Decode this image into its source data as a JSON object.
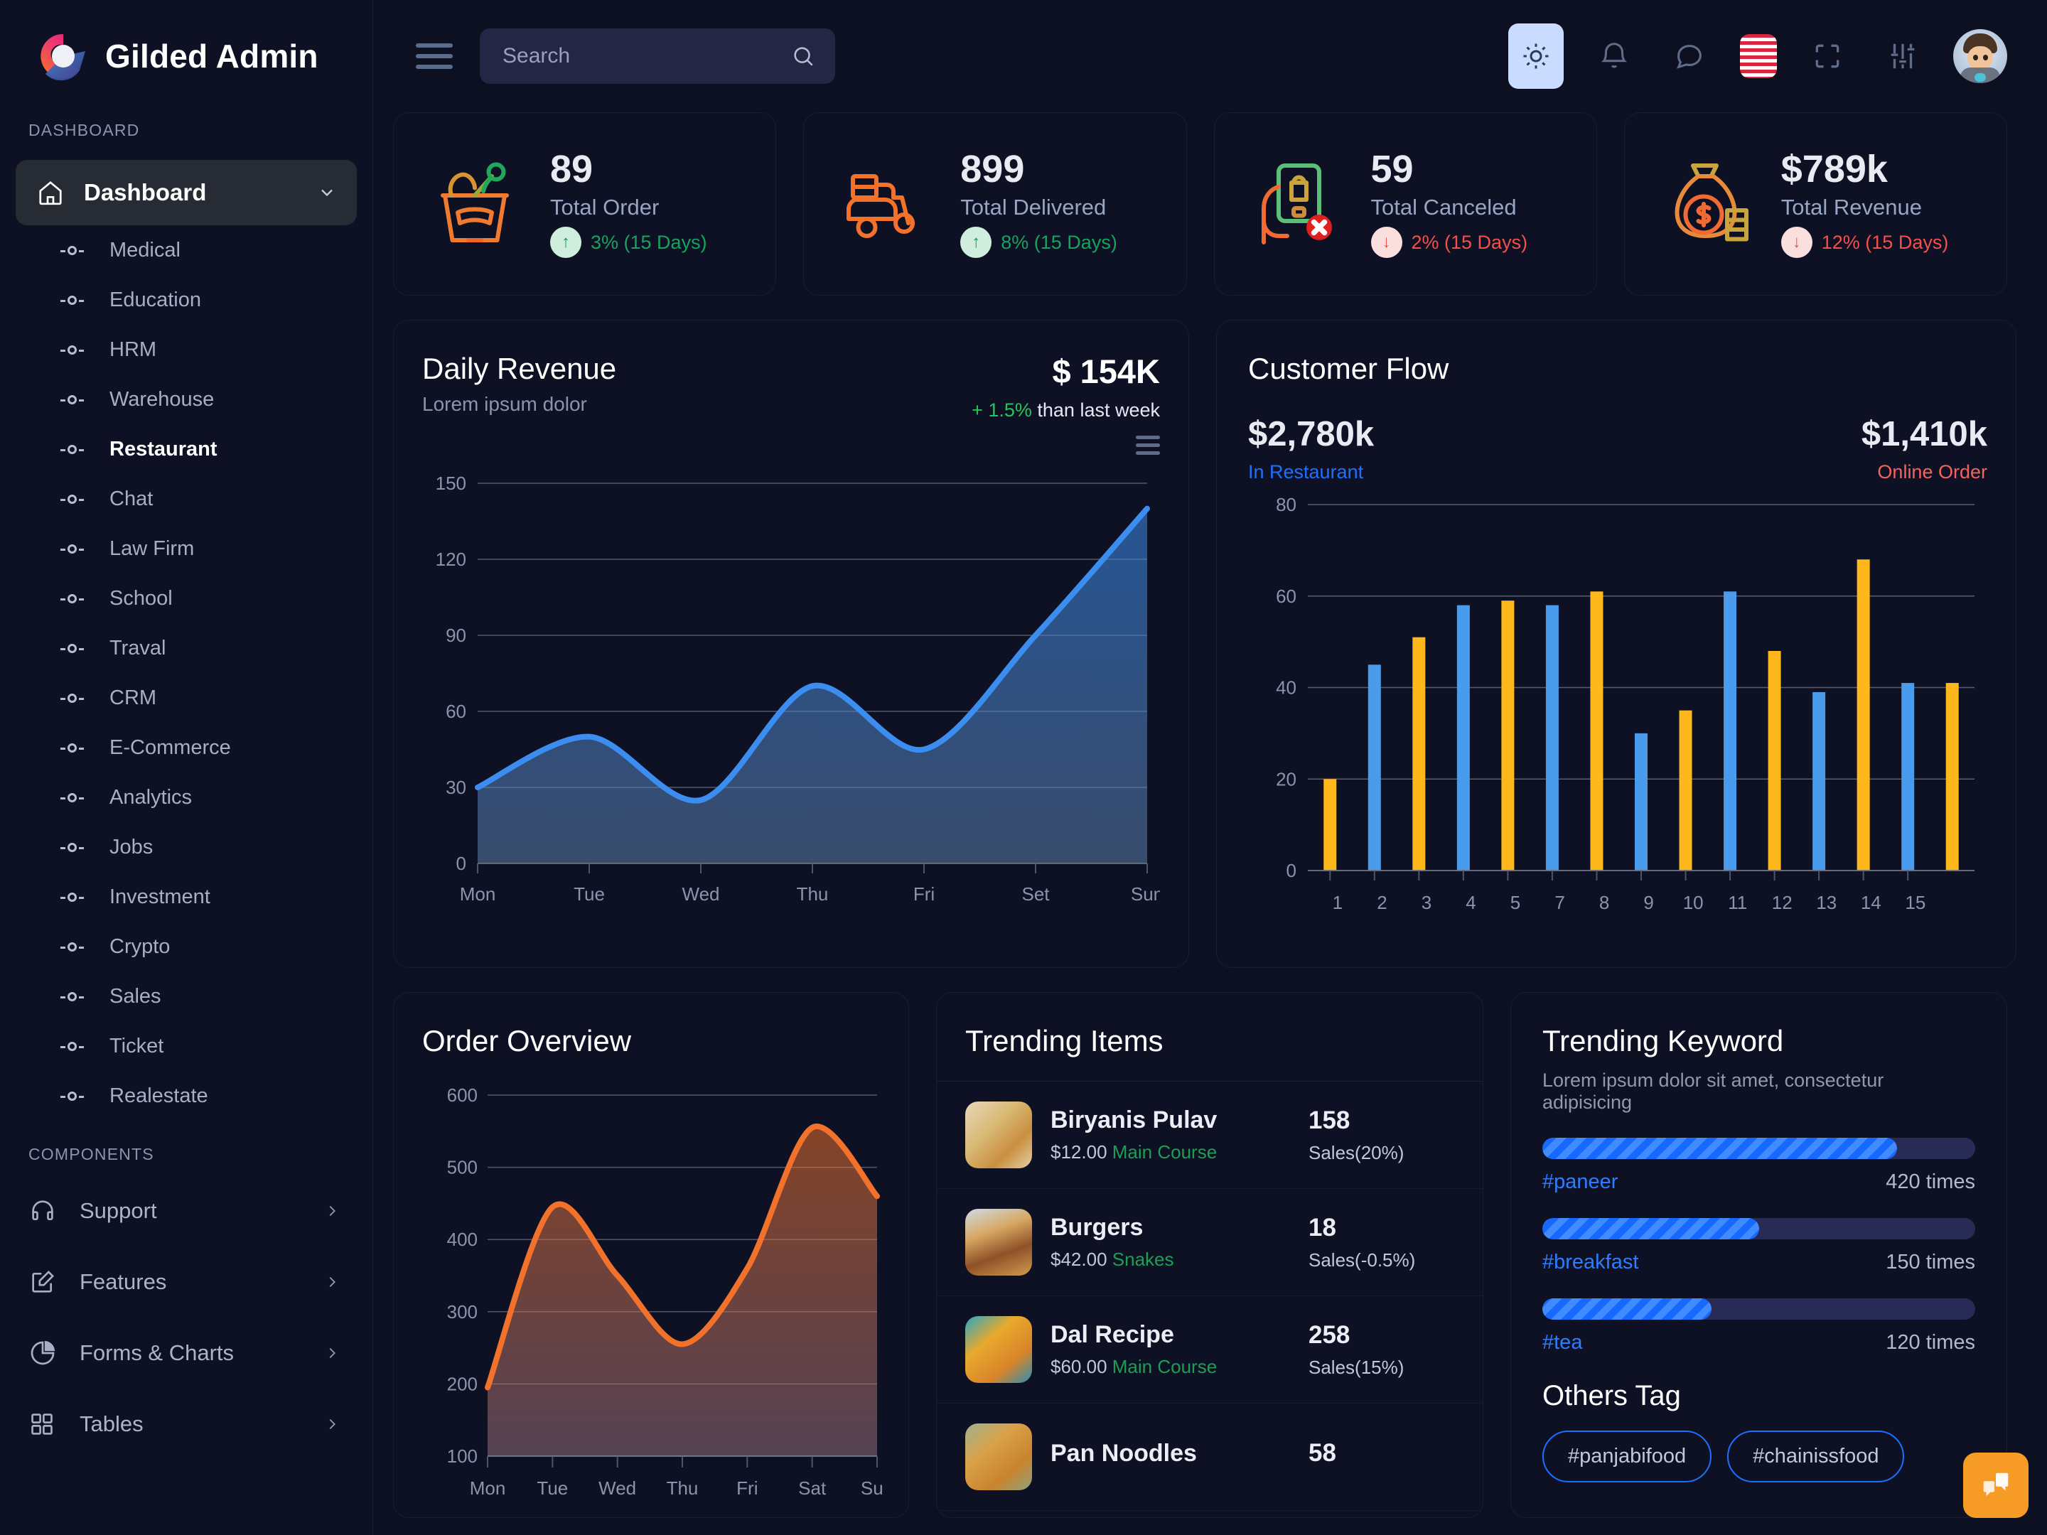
{
  "brand": {
    "name": "Gilded Admin",
    "logo_icon": "gilded-g-logo"
  },
  "sidebar": {
    "section_dashboard": "DASHBOARD",
    "section_components": "COMPONENTS",
    "main_item": {
      "label": "Dashboard",
      "icon": "home-icon",
      "chevron": "chevron-down-icon"
    },
    "sub_items": [
      {
        "label": "Medical",
        "active": false
      },
      {
        "label": "Education",
        "active": false
      },
      {
        "label": "HRM",
        "active": false
      },
      {
        "label": "Warehouse",
        "active": false
      },
      {
        "label": "Restaurant",
        "active": true
      },
      {
        "label": "Chat",
        "active": false
      },
      {
        "label": "Law Firm",
        "active": false
      },
      {
        "label": "School",
        "active": false
      },
      {
        "label": "Traval",
        "active": false
      },
      {
        "label": "CRM",
        "active": false
      },
      {
        "label": "E-Commerce",
        "active": false
      },
      {
        "label": "Analytics",
        "active": false
      },
      {
        "label": "Jobs",
        "active": false
      },
      {
        "label": "Investment",
        "active": false
      },
      {
        "label": "Crypto",
        "active": false
      },
      {
        "label": "Sales",
        "active": false
      },
      {
        "label": "Ticket",
        "active": false
      },
      {
        "label": "Realestate",
        "active": false
      }
    ],
    "components": [
      {
        "label": "Support",
        "icon": "headset-icon"
      },
      {
        "label": "Features",
        "icon": "edit-square-icon"
      },
      {
        "label": "Forms & Charts",
        "icon": "pie-chart-icon"
      },
      {
        "label": "Tables",
        "icon": "grid-icon"
      }
    ]
  },
  "topbar": {
    "menu_icon": "hamburger-icon",
    "search": {
      "placeholder": "Search",
      "value": "",
      "icon": "search-icon"
    },
    "actions": [
      {
        "name": "theme-toggle",
        "icon": "sun-icon"
      },
      {
        "name": "notifications",
        "icon": "bell-icon"
      },
      {
        "name": "messages",
        "icon": "chat-bubble-icon"
      },
      {
        "name": "language",
        "icon": "us-flag-icon"
      },
      {
        "name": "fullscreen",
        "icon": "fullscreen-icon"
      },
      {
        "name": "settings",
        "icon": "sliders-icon"
      },
      {
        "name": "profile",
        "icon": "avatar-icon"
      }
    ]
  },
  "stats": [
    {
      "value": "89",
      "label": "Total Order",
      "delta": "3% (15 Days)",
      "direction": "up",
      "icon": "grocery-basket-icon"
    },
    {
      "value": "899",
      "label": "Total Delivered",
      "delta": "8% (15 Days)",
      "direction": "up",
      "icon": "scooter-delivery-icon"
    },
    {
      "value": "59",
      "label": "Total Canceled",
      "delta": "2% (15 Days)",
      "direction": "down",
      "icon": "cancel-order-icon"
    },
    {
      "value": "$789k",
      "label": "Total Revenue",
      "delta": "12% (15 Days)",
      "direction": "down",
      "icon": "money-bag-icon"
    }
  ],
  "daily_revenue": {
    "title": "Daily Revenue",
    "subtitle": "Lorem ipsum dolor",
    "kpi": "$ 154K",
    "kpi_delta": "+ 1.5%",
    "kpi_delta_rest": " than last week",
    "menu_icon": "hamburger-menu-icon"
  },
  "customer_flow": {
    "title": "Customer Flow",
    "left_value": "$2,780k",
    "left_label": "In Restaurant",
    "right_value": "$1,410k",
    "right_label": "Online Order"
  },
  "order_overview": {
    "title": "Order Overview"
  },
  "trending_items": {
    "title": "Trending Items",
    "items": [
      {
        "name": "Biryanis Pulav",
        "price": "$12.00",
        "category": "Main Course",
        "count": "158",
        "sales": "Sales(20%)",
        "thumb": "biryani-photo"
      },
      {
        "name": "Burgers",
        "price": "$42.00",
        "category": "Snakes",
        "count": "18",
        "sales": "Sales(-0.5%)",
        "thumb": "burger-photo"
      },
      {
        "name": "Dal Recipe",
        "price": "$60.00",
        "category": "Main Course",
        "count": "258",
        "sales": "Sales(15%)",
        "thumb": "dal-photo"
      },
      {
        "name": "Pan Noodles",
        "price": "",
        "category": "",
        "count": "58",
        "sales": "",
        "thumb": "noodles-photo"
      }
    ]
  },
  "trending_keyword": {
    "title": "Trending Keyword",
    "subtitle": "Lorem ipsum dolor sit amet, consectetur adipisicing",
    "keywords": [
      {
        "tag": "#paneer",
        "times": "420 times",
        "percent": 82
      },
      {
        "tag": "#breakfast",
        "times": "150 times",
        "percent": 50
      },
      {
        "tag": "#tea",
        "times": "120 times",
        "percent": 39
      }
    ],
    "others_title": "Others Tag",
    "tags": [
      "#panjabifood",
      "#chainissfood"
    ]
  },
  "fab": {
    "icon": "chat-support-icon",
    "color": "#f59b26"
  },
  "colors": {
    "page_bg": "#0d1020",
    "panel_bg": "#0e1124",
    "accent_blue": "#3b8ef0",
    "accent_orange": "#f2722b",
    "bar_blue": "#4a9bec",
    "bar_yellow": "#ffb81c",
    "positive": "#16a35e",
    "negative": "#f2504b"
  },
  "chart_data": [
    {
      "type": "area",
      "title": "Daily Revenue",
      "categories": [
        "Mon",
        "Tue",
        "Wed",
        "Thu",
        "Fri",
        "Set",
        "Sun"
      ],
      "values": [
        30,
        50,
        25,
        70,
        45,
        90,
        140
      ],
      "yticks": [
        0,
        30,
        60,
        90,
        120,
        150
      ],
      "ylim": [
        0,
        150
      ],
      "xlabel": "",
      "ylabel": "",
      "grid": true,
      "series_color": "#3b8ef0"
    },
    {
      "type": "bar",
      "title": "Customer Flow",
      "categories": [
        "1",
        "2",
        "3",
        "4",
        "5",
        "7",
        "8",
        "9",
        "10",
        "11",
        "12",
        "13",
        "14",
        "15"
      ],
      "values": [
        20,
        45,
        51,
        58,
        59,
        58,
        61,
        30,
        35,
        61,
        48,
        39,
        68,
        41,
        41
      ],
      "bar_colors": [
        "yellow",
        "blue",
        "yellow",
        "blue",
        "yellow",
        "blue",
        "yellow",
        "blue",
        "yellow",
        "blue",
        "yellow",
        "blue",
        "yellow",
        "blue",
        "yellow"
      ],
      "yticks": [
        0,
        20,
        40,
        60,
        80
      ],
      "ylim": [
        0,
        80
      ],
      "grid": true,
      "legend": [
        "In Restaurant",
        "Online Order"
      ]
    },
    {
      "type": "area",
      "title": "Order Overview",
      "categories": [
        "Mon",
        "Tue",
        "Wed",
        "Thu",
        "Fri",
        "Sat",
        "Sun"
      ],
      "values": [
        195,
        445,
        350,
        255,
        360,
        555,
        460
      ],
      "yticks": [
        100,
        200,
        300,
        400,
        500,
        600
      ],
      "ylim": [
        100,
        600
      ],
      "grid": true,
      "series_color": "#f2722b"
    }
  ]
}
